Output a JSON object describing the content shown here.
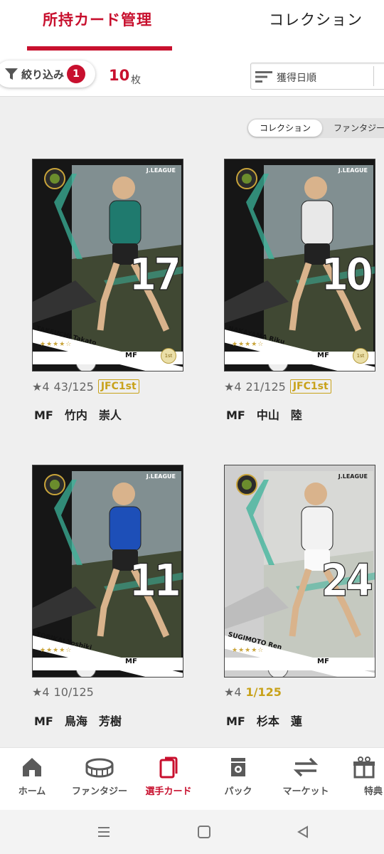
{
  "tabs": {
    "active": "所持カード管理",
    "other": "コレクション"
  },
  "filter": {
    "label": "絞り込み",
    "badge": "1"
  },
  "count": {
    "value": "10",
    "unit": "枚"
  },
  "sort": {
    "label": "獲得日順"
  },
  "view_toggle": {
    "on": "コレクション",
    "off": "ファンタジー"
  },
  "cards": [
    {
      "card_name": "TAKEUCHI Takato",
      "number": "17",
      "position": "MF",
      "league": "J.LEAGUE",
      "rarity": "★4",
      "serial": "43/125",
      "tag": "JFC1st",
      "badge": "1st",
      "player_line": "MF　竹内　崇人",
      "accent": "#1f7a6e"
    },
    {
      "card_name": "NAKAYAMA Riku",
      "number": "10",
      "position": "MF",
      "league": "J.LEAGUE",
      "rarity": "★4",
      "serial": "21/125",
      "tag": "JFC1st",
      "badge": "1st",
      "player_line": "MF　中山　陸",
      "accent": "#e8e8e8"
    },
    {
      "card_name": "TORIKAI Yoshiki",
      "number": "11",
      "position": "MF",
      "league": "J.LEAGUE",
      "rarity": "★4",
      "serial": "10/125",
      "tag": "",
      "badge": "",
      "player_line": "MF　鳥海　芳樹",
      "accent": "#1d4fb8"
    },
    {
      "card_name": "SUGIMOTO Ren",
      "number": "24",
      "position": "MF",
      "league": "J.LEAGUE",
      "rarity": "★4",
      "serial": "1/125",
      "tag": "",
      "badge": "",
      "player_line": "MF　杉本　蓮",
      "accent": "#f2f2f2"
    }
  ],
  "nav": [
    {
      "label": "ホーム",
      "icon": "home-icon"
    },
    {
      "label": "ファンタジー",
      "icon": "stadium-icon"
    },
    {
      "label": "選手カード",
      "icon": "cards-icon"
    },
    {
      "label": "パック",
      "icon": "pack-icon"
    },
    {
      "label": "マーケット",
      "icon": "exchange-icon"
    },
    {
      "label": "特典",
      "icon": "gift-icon"
    }
  ],
  "colors": {
    "brand": "#c8102e",
    "gold": "#c8a21a"
  }
}
